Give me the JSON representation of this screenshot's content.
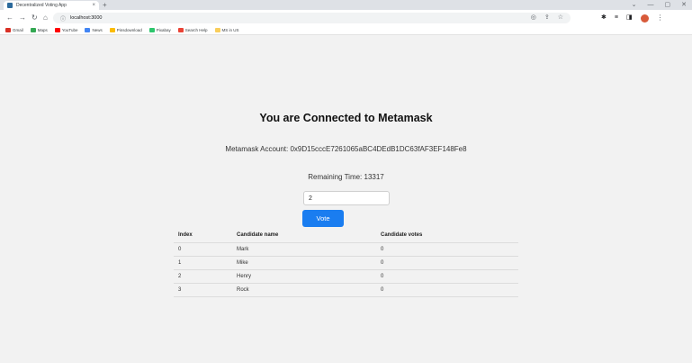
{
  "browser": {
    "tab_title": "Decentralized Voting App",
    "tab_close": "×",
    "new_tab": "+",
    "url": "localhost:3000",
    "win_minimize": "—",
    "win_restore": "▢",
    "win_close": "✕",
    "bookmarks": [
      {
        "label": "Gmail",
        "color": "#d93025"
      },
      {
        "label": "Maps",
        "color": "#34a853"
      },
      {
        "label": "YouTube",
        "color": "#ff0000"
      },
      {
        "label": "News",
        "color": "#4285f4"
      },
      {
        "label": "Pinsdownload",
        "color": "#fbbc04"
      },
      {
        "label": "Pixabay",
        "color": "#2ec66d"
      },
      {
        "label": "Search Help",
        "color": "#ea4335"
      },
      {
        "label": "MS in US",
        "color": "#f9ce5c"
      }
    ]
  },
  "main": {
    "heading": "You are Connected to Metamask",
    "account": "Metamask Account: 0x9D15cccE7261065aBC4DEdB1DC63fAF3EF148Fe8",
    "remaining": "Remaining Time: 13317",
    "input_value": "2",
    "vote_label": "Vote",
    "accent_color": "#1a7df0"
  },
  "table": {
    "headers": [
      "Index",
      "Candidate name",
      "Candidate votes"
    ],
    "rows": [
      {
        "index": "0",
        "name": "Mark",
        "votes": "0"
      },
      {
        "index": "1",
        "name": "Mike",
        "votes": "0"
      },
      {
        "index": "2",
        "name": "Henry",
        "votes": "0"
      },
      {
        "index": "3",
        "name": "Rock",
        "votes": "0"
      }
    ]
  }
}
